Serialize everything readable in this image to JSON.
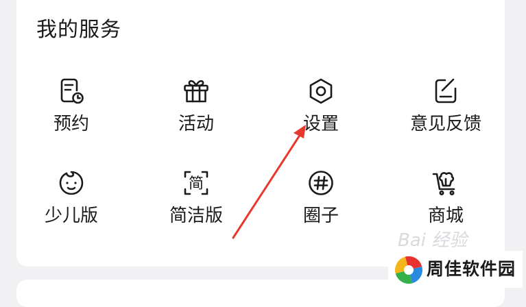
{
  "section": {
    "title": "我的服务"
  },
  "services": [
    {
      "label": "预约",
      "icon": "booking-icon"
    },
    {
      "label": "活动",
      "icon": "gift-icon"
    },
    {
      "label": "设置",
      "icon": "settings-icon"
    },
    {
      "label": "意见反馈",
      "icon": "feedback-icon"
    },
    {
      "label": "少儿版",
      "icon": "kid-face-icon"
    },
    {
      "label": "简洁版",
      "icon": "simple-mode-icon"
    },
    {
      "label": "圈子",
      "icon": "hashtag-icon"
    },
    {
      "label": "商城",
      "icon": "mall-cart-icon"
    }
  ],
  "simple_icon_glyph": "简",
  "watermark": {
    "text": "Bai 经验"
  },
  "site_logo": {
    "text": "周佳软件园"
  },
  "colors": {
    "background": "#f1f1f3",
    "card": "#ffffff",
    "text": "#1a1a1a",
    "annotation_arrow": "#e8372e"
  }
}
